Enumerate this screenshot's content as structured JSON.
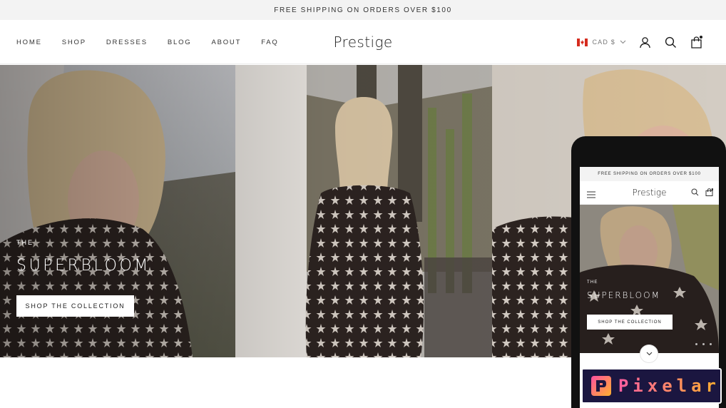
{
  "announcement": "FREE SHIPPING ON ORDERS OVER $100",
  "nav": {
    "items": [
      {
        "label": "HOME"
      },
      {
        "label": "SHOP"
      },
      {
        "label": "DRESSES"
      },
      {
        "label": "BLOG"
      },
      {
        "label": "ABOUT"
      },
      {
        "label": "FAQ"
      }
    ]
  },
  "brand": "Prestige",
  "header_right": {
    "currency": "CAD $",
    "flag_colors": [
      "#d52b1e",
      "#ffffff",
      "#d52b1e"
    ],
    "icons": [
      "account-icon",
      "search-icon",
      "cart-icon"
    ]
  },
  "hero": {
    "kicker": "THE",
    "title": "SUPERBLOOM",
    "cta": "SHOP THE COLLECTION"
  },
  "mobile": {
    "announcement": "FREE SHIPPING ON ORDERS OVER $100",
    "brand": "Prestige",
    "kicker": "THE",
    "title": "SUPERBLOOM",
    "cta": "SHOP THE COLLECTION"
  },
  "watermark": "Pixelar"
}
